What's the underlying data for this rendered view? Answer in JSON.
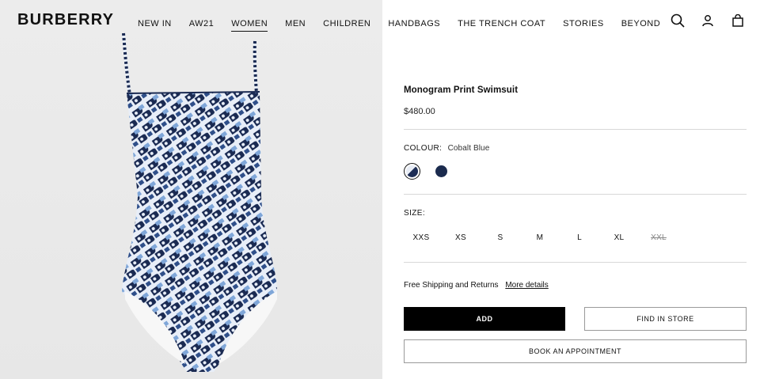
{
  "header": {
    "logo": "BURBERRY",
    "nav": [
      {
        "label": "NEW IN"
      },
      {
        "label": "AW21"
      },
      {
        "label": "WOMEN"
      },
      {
        "label": "MEN"
      },
      {
        "label": "CHILDREN"
      },
      {
        "label": "HANDBAGS"
      },
      {
        "label": "THE TRENCH COAT"
      },
      {
        "label": "STORIES"
      },
      {
        "label": "BEYOND"
      }
    ],
    "active_nav": "WOMEN",
    "icons": [
      "search-icon",
      "account-icon",
      "bag-icon"
    ]
  },
  "product": {
    "name": "Monogram Print Swimsuit",
    "price": "$480.00",
    "colour_label": "COLOUR:",
    "colour_value": "Cobalt Blue",
    "swatches": [
      {
        "name": "Cobalt Blue",
        "selected": true,
        "colors": [
          "#e7ecf5",
          "#1d2d55"
        ]
      },
      {
        "name": "Navy",
        "selected": false,
        "colors": [
          "#1b2b4e"
        ]
      }
    ],
    "size_label": "SIZE:",
    "sizes": [
      {
        "label": "XXS",
        "available": true
      },
      {
        "label": "XS",
        "available": true
      },
      {
        "label": "S",
        "available": true
      },
      {
        "label": "M",
        "available": true
      },
      {
        "label": "L",
        "available": true
      },
      {
        "label": "XL",
        "available": true
      },
      {
        "label": "XXL",
        "available": false
      }
    ],
    "shipping_text": "Free Shipping and Returns",
    "shipping_link": "More details",
    "add_label": "ADD",
    "find_in_store_label": "FIND IN STORE",
    "appointment_label": "BOOK AN APPOINTMENT"
  },
  "colors": {
    "accent": "#000000",
    "background": "#ffffff",
    "image_bg": "#e9e9e9",
    "print_dark": "#1a2a52",
    "print_light": "#e8eef8",
    "print_mid": "#7fa6d8"
  }
}
